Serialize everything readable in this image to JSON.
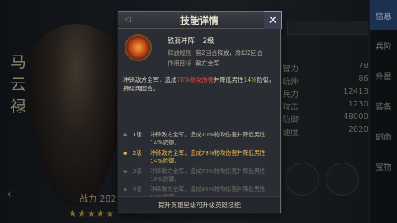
{
  "background": {
    "hero_name": "马云禄",
    "power_label": "战力 282",
    "stars": "★★★★★",
    "right_tabs": [
      "信息",
      "兵阶",
      "升星",
      "装备",
      "副命",
      "宝物"
    ],
    "stats": [
      {
        "label": "智力",
        "value": "78"
      },
      {
        "label": "统帅",
        "value": "86"
      },
      {
        "label": "兵力",
        "value": "12413"
      },
      {
        "label": "攻击",
        "value": "1230"
      },
      {
        "label": "防御",
        "value": "48000"
      },
      {
        "label": "速度",
        "value": "2820"
      }
    ]
  },
  "dialog": {
    "title": "技能详情",
    "close_icon": "close-icon",
    "skill": {
      "name": "铁骑冲阵",
      "level": "2级",
      "rule_label": "释放规则",
      "rule_value": "第2回合释放，冷却2回合",
      "target_label": "作用目标",
      "target_value": "敌方全军"
    },
    "description": {
      "part1": "冲锋敌方全军，造成",
      "pct1": "78%",
      "mid1": "物攻伤害",
      "part2": "并降低男性",
      "pct2": "14%",
      "part3": "防御，持续两回合。"
    },
    "levels": [
      {
        "level": "1级",
        "text": "冲锋敌方全军，造成70%物攻伤害并降低男性14%防御。",
        "state": "unlocked"
      },
      {
        "level": "2级",
        "text": "冲锋敌方全军，造成78%物攻伤害并降低男性14%防御。",
        "state": "current"
      },
      {
        "level": "3级",
        "text": "冲锋敌方全军，造成78%物攻伤害并降低男性18%防御。",
        "state": "locked"
      },
      {
        "level": "4级",
        "text": "冲锋敌方全军，造成86%物攻伤害并降低男性18%防御。",
        "state": "locked"
      }
    ],
    "footer": "提升英雄星级可升级英雄技能"
  }
}
